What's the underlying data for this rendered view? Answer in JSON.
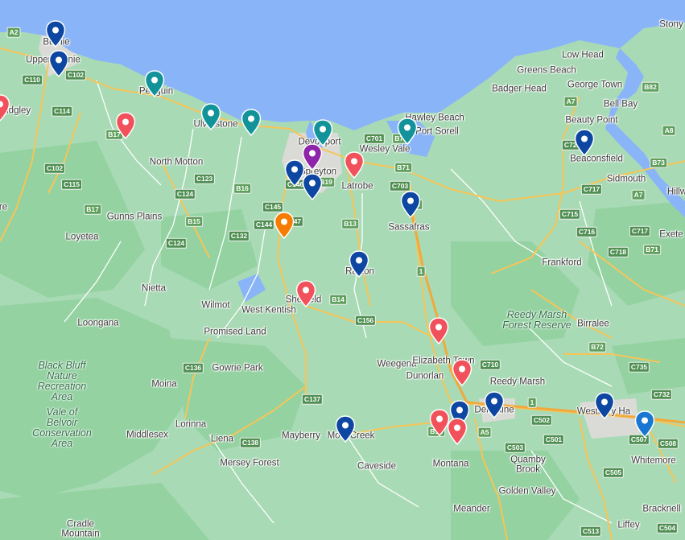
{
  "map": {
    "colors": {
      "water": "#8ab4f8",
      "land": "#a8dab5",
      "forest": "#94d2a1",
      "roads": "#f6c557",
      "marker_navy": "#0d47a1",
      "marker_teal": "#12939a",
      "marker_red": "#f1515b",
      "marker_purple": "#8e24aa",
      "marker_orange": "#f57c00",
      "marker_blue": "#1976d2"
    },
    "places": [
      {
        "id": "stony",
        "label": "Stony"
      },
      {
        "id": "burnie",
        "label": "Burnie"
      },
      {
        "id": "upper-burnie",
        "label": "Upper Burnie"
      },
      {
        "id": "low-head",
        "label": "Low Head"
      },
      {
        "id": "greens-beach",
        "label": "Greens Beach"
      },
      {
        "id": "george-town",
        "label": "George Town"
      },
      {
        "id": "badger-head",
        "label": "Badger Head"
      },
      {
        "id": "penguin",
        "label": "Penguin"
      },
      {
        "id": "bell-bay",
        "label": "Bell Bay"
      },
      {
        "id": "ridgley",
        "label": "Ridgley"
      },
      {
        "id": "hawley-beach",
        "label": "Hawley Beach"
      },
      {
        "id": "port-sorell",
        "label": "Port Sorell"
      },
      {
        "id": "ulverstone",
        "label": "Ulverstone"
      },
      {
        "id": "beauty-point",
        "label": "Beauty Point"
      },
      {
        "id": "devonport",
        "label": "Devonport"
      },
      {
        "id": "wesley-vale",
        "label": "Wesley Vale"
      },
      {
        "id": "beaconsfield",
        "label": "Beaconsfield"
      },
      {
        "id": "north-motton",
        "label": "North Motton"
      },
      {
        "id": "spreyton",
        "label": "Spreyton"
      },
      {
        "id": "latrobe",
        "label": "Latrobe"
      },
      {
        "id": "sidmouth",
        "label": "Sidmouth"
      },
      {
        "id": "hillwood",
        "label": "Hillw"
      },
      {
        "id": "gunns-plains",
        "label": "Gunns Plains"
      },
      {
        "id": "loyetea",
        "label": "Loyetea"
      },
      {
        "id": "sassafras",
        "label": "Sassafras"
      },
      {
        "id": "exeter",
        "label": "Exete"
      },
      {
        "id": "frankford",
        "label": "Frankford"
      },
      {
        "id": "railton",
        "label": "Railton"
      },
      {
        "id": "nietta",
        "label": "Nietta"
      },
      {
        "id": "sheffield",
        "label": "Sheffield"
      },
      {
        "id": "wilmot",
        "label": "Wilmot"
      },
      {
        "id": "west-kentish",
        "label": "West Kentish"
      },
      {
        "id": "birralee",
        "label": "Birralee"
      },
      {
        "id": "loongana",
        "label": "Loongana"
      },
      {
        "id": "promised-land",
        "label": "Promised Land"
      },
      {
        "id": "weegena",
        "label": "Weegena"
      },
      {
        "id": "elizabeth-town",
        "label": "Elizabeth Town"
      },
      {
        "id": "gowrie-park",
        "label": "Gowrie Park"
      },
      {
        "id": "dunorlan",
        "label": "Dunorlan"
      },
      {
        "id": "reedy-marsh",
        "label": "Reedy Marsh"
      },
      {
        "id": "moina",
        "label": "Moina"
      },
      {
        "id": "deloraine",
        "label": "Deloraine"
      },
      {
        "id": "westbury",
        "label": "Westbury Ha"
      },
      {
        "id": "lorinna",
        "label": "Lorinna"
      },
      {
        "id": "middlesex",
        "label": "Middlesex"
      },
      {
        "id": "mayberry",
        "label": "Mayberry"
      },
      {
        "id": "mole-creek",
        "label": "Mole Creek"
      },
      {
        "id": "liena",
        "label": "Liena"
      },
      {
        "id": "whitemore",
        "label": "Whitemore"
      },
      {
        "id": "montana",
        "label": "Montana"
      },
      {
        "id": "quamby-brook",
        "label": "Quamby\nBrook"
      },
      {
        "id": "caveside",
        "label": "Caveside"
      },
      {
        "id": "mersey-forest",
        "label": "Mersey Forest"
      },
      {
        "id": "golden-valley",
        "label": "Golden Valley"
      },
      {
        "id": "meander",
        "label": "Meander"
      },
      {
        "id": "bracknell",
        "label": "Bracknell"
      },
      {
        "id": "cradle-mountain",
        "label": "Cradle\nMountain"
      },
      {
        "id": "liffey",
        "label": "Liffey"
      },
      {
        "id": "ridgley-edge",
        "label": "re"
      }
    ],
    "reserves": [
      {
        "id": "reedy-marsh-fr",
        "label": "Reedy Marsh\nForest Reserve"
      },
      {
        "id": "black-bluff",
        "label": "Black Bluff\nNature\nRecreation\nArea"
      },
      {
        "id": "vale-of-belvoir",
        "label": "Vale of\nBelvoir\nConservation\nArea"
      }
    ],
    "road_shields": [
      "A2",
      "C110",
      "C102",
      "C114",
      "B17",
      "C102",
      "C115",
      "B17",
      "C123",
      "C124",
      "B16",
      "B15",
      "C124",
      "C132",
      "C144",
      "C145",
      "C146",
      "B19",
      "C147",
      "B13",
      "C701",
      "B74",
      "B71",
      "C703",
      "B13",
      "1",
      "B14",
      "C156",
      "C710",
      "C136",
      "C137",
      "C138",
      "B12",
      "A5",
      "C502",
      "C503",
      "C501",
      "1",
      "B82",
      "A7",
      "A8",
      "B73",
      "C725",
      "C717",
      "A7",
      "C715",
      "C716",
      "C718",
      "C717",
      "B71",
      "B72",
      "C735",
      "C732",
      "C507",
      "C508",
      "C505",
      "C513",
      "C504"
    ],
    "markers": [
      {
        "id": "m-burnie",
        "color": "navy"
      },
      {
        "id": "m-upper-burnie",
        "color": "navy"
      },
      {
        "id": "m-penguin",
        "color": "teal"
      },
      {
        "id": "m-ulverstone-1",
        "color": "teal"
      },
      {
        "id": "m-ulverstone-2",
        "color": "teal"
      },
      {
        "id": "m-devonport-east",
        "color": "teal"
      },
      {
        "id": "m-hawley",
        "color": "teal"
      },
      {
        "id": "m-ridgley-edge",
        "color": "red"
      },
      {
        "id": "m-b17",
        "color": "red"
      },
      {
        "id": "m-devonport-purple",
        "color": "purple"
      },
      {
        "id": "m-wesley-vale",
        "color": "red"
      },
      {
        "id": "m-spreyton-1",
        "color": "navy"
      },
      {
        "id": "m-spreyton-2",
        "color": "navy"
      },
      {
        "id": "m-latrobe",
        "color": "navy"
      },
      {
        "id": "m-c147",
        "color": "orange"
      },
      {
        "id": "m-railton",
        "color": "navy"
      },
      {
        "id": "m-sheffield",
        "color": "red"
      },
      {
        "id": "m-elizabeth-n",
        "color": "red"
      },
      {
        "id": "m-elizabeth-s",
        "color": "red"
      },
      {
        "id": "m-beauty-point",
        "color": "navy"
      },
      {
        "id": "m-deloraine-1",
        "color": "navy"
      },
      {
        "id": "m-deloraine-2",
        "color": "navy"
      },
      {
        "id": "m-deloraine-red-1",
        "color": "red"
      },
      {
        "id": "m-deloraine-red-2",
        "color": "red"
      },
      {
        "id": "m-mole-creek",
        "color": "navy"
      },
      {
        "id": "m-westbury",
        "color": "navy"
      },
      {
        "id": "m-westbury-e",
        "color": "blue"
      }
    ]
  }
}
